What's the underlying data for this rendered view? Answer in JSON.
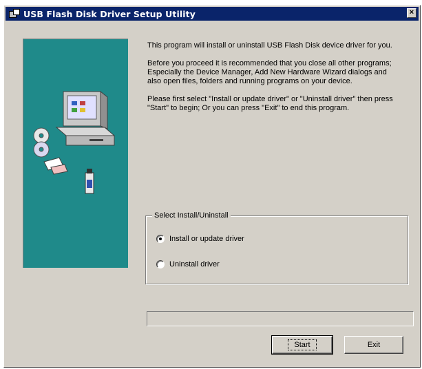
{
  "window": {
    "title": "USB Flash Disk Driver Setup Utility",
    "close_glyph": "×",
    "app_icon": "setup-app-icon",
    "colors": {
      "titlebar": "#0a246a",
      "face": "#d4d0c8",
      "side_panel": "#1f8a8a"
    }
  },
  "side_panel": {
    "illustration": "computer-with-cds-and-flash-drive"
  },
  "intro": {
    "paragraph1": "This program will install or uninstall USB Flash Disk device driver for you.",
    "paragraph2": "Before you proceed it is recommended that you close all other programs; Especially the Device Manager, Add New Hardware Wizard dialogs and also open files, folders and running programs on your device.",
    "paragraph3": "Please first select \"Install or update driver\" or \"Uninstall driver\" then press \"Start\" to begin; Or you can press \"Exit\" to end this program."
  },
  "options": {
    "legend": "Select Install/Uninstall",
    "install": {
      "label": "Install or update driver",
      "checked": true
    },
    "uninstall": {
      "label": "Uninstall driver",
      "checked": false
    }
  },
  "progress": {
    "fraction": 0
  },
  "buttons": {
    "start": "Start",
    "exit": "Exit"
  }
}
